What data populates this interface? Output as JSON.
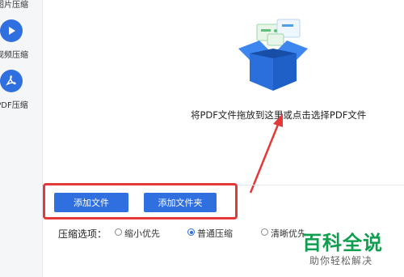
{
  "sidebar": {
    "items": [
      {
        "label": "图片压缩",
        "icon": "image-compress-icon"
      },
      {
        "label": "视频压缩",
        "icon": "play-icon"
      },
      {
        "label": "PDF压缩",
        "icon": "pdf-icon"
      }
    ]
  },
  "dropzone": {
    "hint": "将PDF文件拖放到这里或点击选择PDF文件",
    "illustration": "open-box-with-documents"
  },
  "buttons": {
    "add_file": "添加文件",
    "add_folder": "添加文件夹"
  },
  "compress_options": {
    "label": "压缩选项：",
    "options": [
      {
        "label": "缩小优先",
        "checked": false
      },
      {
        "label": "普通压缩",
        "checked": true
      },
      {
        "label": "清晰优先",
        "checked": false
      }
    ]
  },
  "watermark": {
    "title": "百科全说",
    "subtitle": "助你轻松解决"
  },
  "colors": {
    "accent": "#2f6fe0",
    "highlight_red": "#e23a3a",
    "watermark_green": "#0f9e4f"
  }
}
